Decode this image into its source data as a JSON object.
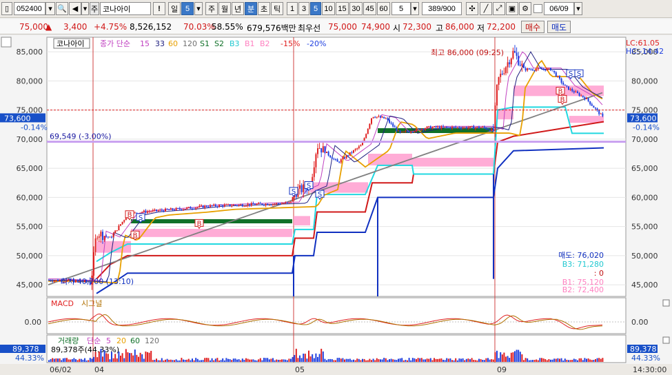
{
  "toolbar": {
    "code": "052400",
    "stock_name": "코나아이",
    "stock_prefix": "주",
    "alert_label": "!",
    "period_day": "일",
    "period_value": "5",
    "period_week": "주",
    "period_month": "월",
    "period_year": "년",
    "period_minute": "분",
    "period_second": "초",
    "period_tick": "틱",
    "intervals": [
      "1",
      "3",
      "5",
      "10",
      "15",
      "30",
      "45",
      "60"
    ],
    "interval_selected": "5",
    "count_value": "5",
    "count_display": "389/900",
    "date_field": "06/09",
    "colors": {
      "selected": "#3a78c8"
    }
  },
  "quote": {
    "price": "75,000",
    "change": "3,400",
    "change_pct": "+4.75%",
    "volume": "8,526,152",
    "volume_ratio": "70.03%",
    "rate2": "58.55%",
    "amount": "679,576백만",
    "ask_label": "최우선",
    "ask": "75,000",
    "bid": "74,900",
    "open_label": "시",
    "open": "72,300",
    "high_label": "고",
    "high": "86,000",
    "low_label": "저",
    "low": "72,200",
    "sell_button": "매수",
    "buy_button": "매도",
    "up_arrow": "▲"
  },
  "chart_data": {
    "type": "candlestick",
    "legend": {
      "name": "코나아이",
      "ma_label": "종가 단순",
      "ma_periods": [
        {
          "label": "15",
          "color": "#c040c0"
        },
        {
          "label": "33",
          "color": "#202080"
        },
        {
          "label": "60",
          "color": "#e8a000"
        },
        {
          "label": "120",
          "color": "#707070"
        }
      ],
      "s1": "S1",
      "s2": "S2",
      "b3": "B3",
      "b1": "B1",
      "b2": "B2",
      "pct_neg15": "-15%",
      "pct_neg20": "-20%"
    },
    "y_ticks": [
      "85,000",
      "80,000",
      "75,000",
      "70,000",
      "65,000",
      "60,000",
      "55,000",
      "50,000",
      "45,000"
    ],
    "y_values": [
      85000,
      80000,
      75000,
      70000,
      65000,
      60000,
      55000,
      50000,
      45000
    ],
    "ylim": [
      43000,
      87500
    ],
    "current_price": "73,600",
    "current_pct": "-0.14%",
    "current_value": 73600,
    "ref_line_value": 75000,
    "lc_label": "LC:61.05",
    "hc_label": "HC:-14.42",
    "max_label": "최고 86,000 (09:25)",
    "min_label": "최저 40,700 (13:10)",
    "h_line_label": "69,549 (-3.00%)",
    "h_line_value": 69549,
    "signals": {
      "sell": "매도: 76,020",
      "b3": "B3: 71,280",
      "zero": ": 0",
      "b1": "B1: 75,120",
      "b2": "B2: 72,400"
    },
    "x_labels": [
      "06/02",
      "04",
      "05",
      "09"
    ],
    "time_label": "14:30:00",
    "macd": {
      "title": "MACD",
      "signal": "시그널",
      "zero_label": "0.00"
    },
    "volume": {
      "title": "거래량",
      "ma_label": "단순",
      "ma_periods": [
        "5",
        "20",
        "60",
        "120"
      ],
      "value_label": "89,378주(44.33%)",
      "left_value": "89,378",
      "left_pct": "44.33%"
    },
    "colors": {
      "up": "#e02020",
      "down": "#2040e0",
      "band": "#ff9ecf"
    }
  }
}
